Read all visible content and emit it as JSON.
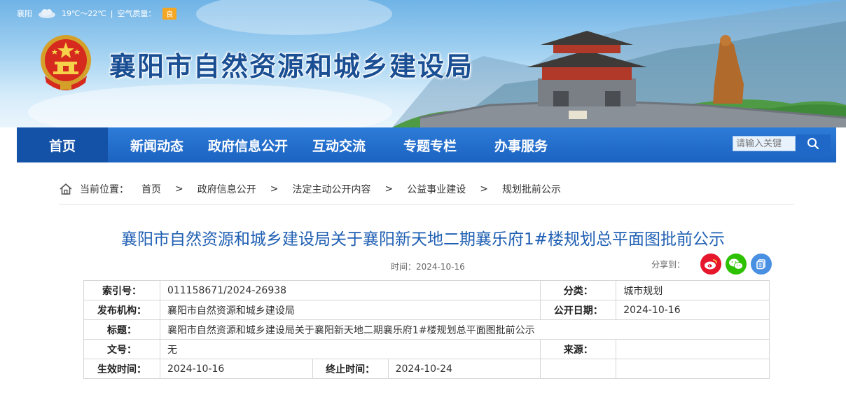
{
  "weather": {
    "city": "襄阳",
    "temperature": "19℃～22℃",
    "separator": "|",
    "air_quality_label": "空气质量：",
    "air_quality_value": "良"
  },
  "header": {
    "site_title": "襄阳市自然资源和城乡建设局"
  },
  "nav": {
    "items": [
      {
        "label": "首页",
        "active": true
      },
      {
        "label": "新闻动态"
      },
      {
        "label": "政府信息公开"
      },
      {
        "label": "互动交流"
      },
      {
        "label": "专题专栏"
      },
      {
        "label": "办事服务"
      }
    ],
    "search_placeholder": "请输入关键"
  },
  "breadcrumb": {
    "prefix": "当前位置：",
    "items": [
      "首页",
      "政府信息公开",
      "法定主动公开内容",
      "公益事业建设",
      "规划批前公示"
    ],
    "separator": ">"
  },
  "article": {
    "title": "襄阳市自然资源和城乡建设局关于襄阳新天地二期襄乐府1#楼规划总平面图批前公示",
    "time_label": "时间：",
    "time_value": "2024-10-16",
    "share_label": "分享到："
  },
  "meta_table": {
    "index_label": "索引号：",
    "index_value": "011158671/2024-26938",
    "category_label": "分类：",
    "category_value": "城市规划",
    "publisher_label": "发布机构：",
    "publisher_value": "襄阳市自然资源和城乡建设局",
    "pub_date_label": "公开日期：",
    "pub_date_value": "2024-10-16",
    "title_label": "标题：",
    "title_value": "襄阳市自然资源和城乡建设局关于襄阳新天地二期襄乐府1#楼规划总平面图批前公示",
    "doc_no_label": "文号：",
    "doc_no_value": "无",
    "source_label": "来源：",
    "source_value": "",
    "effective_label": "生效时间：",
    "effective_value": "2024-10-16",
    "expiry_label": "终止时间：",
    "expiry_value": "2024-10-24"
  },
  "colors": {
    "nav_blue": "#1c63c0",
    "title_blue": "#1f5fb3",
    "weibo_red": "#e6162d",
    "wechat_green": "#2dc100",
    "copy_blue": "#4a90e2"
  },
  "icons": {
    "home": "home-icon",
    "search": "search-icon",
    "weibo": "weibo-icon",
    "wechat": "wechat-icon",
    "copy": "copy-icon",
    "emblem": "national-emblem",
    "weather": "cloud-icon"
  }
}
